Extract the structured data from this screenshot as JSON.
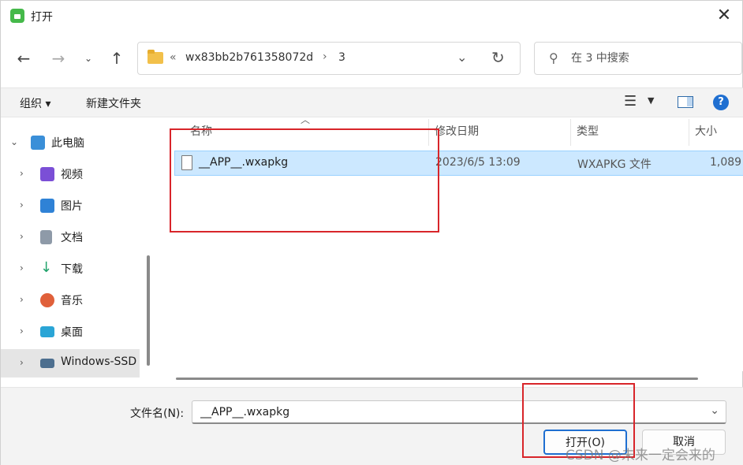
{
  "window": {
    "title": "打开"
  },
  "address": {
    "segments": [
      "wx83bb2b761358072d",
      "3"
    ],
    "overflow": "«"
  },
  "search": {
    "placeholder": "在 3 中搜索"
  },
  "toolbar": {
    "organize": "组织 ▾",
    "new_folder": "新建文件夹"
  },
  "sidebar": {
    "items": [
      {
        "label": "此电脑",
        "icon": "computer-icon",
        "color": "#3a8fd8"
      },
      {
        "label": "视频",
        "icon": "video-icon",
        "color": "#7b4fd6"
      },
      {
        "label": "图片",
        "icon": "picture-icon",
        "color": "#2f82d6"
      },
      {
        "label": "文档",
        "icon": "document-icon",
        "color": "#8e9aa8"
      },
      {
        "label": "下载",
        "icon": "download-icon",
        "color": "#20a26b"
      },
      {
        "label": "音乐",
        "icon": "music-icon",
        "color": "#e0603a"
      },
      {
        "label": "桌面",
        "icon": "desktop-icon",
        "color": "#2aa5d6"
      },
      {
        "label": "Windows-SSD",
        "icon": "drive-icon",
        "color": "#4d6f8f"
      }
    ]
  },
  "columns": {
    "name": "名称",
    "modified": "修改日期",
    "type": "类型",
    "size": "大小"
  },
  "files": [
    {
      "name": "__APP__.wxapkg",
      "modified": "2023/6/5 13:09",
      "type": "WXAPKG 文件",
      "size": "1,089"
    }
  ],
  "footer": {
    "filename_label": "文件名(N):",
    "filename_value": "__APP__.wxapkg",
    "open_label": "打开(O)",
    "cancel_label": "取消"
  },
  "watermark": "CSDN @未来一定会来的",
  "colors": {
    "accent": "#1f6fd1",
    "selection": "#cce8ff",
    "annotation": "#d8252a"
  }
}
